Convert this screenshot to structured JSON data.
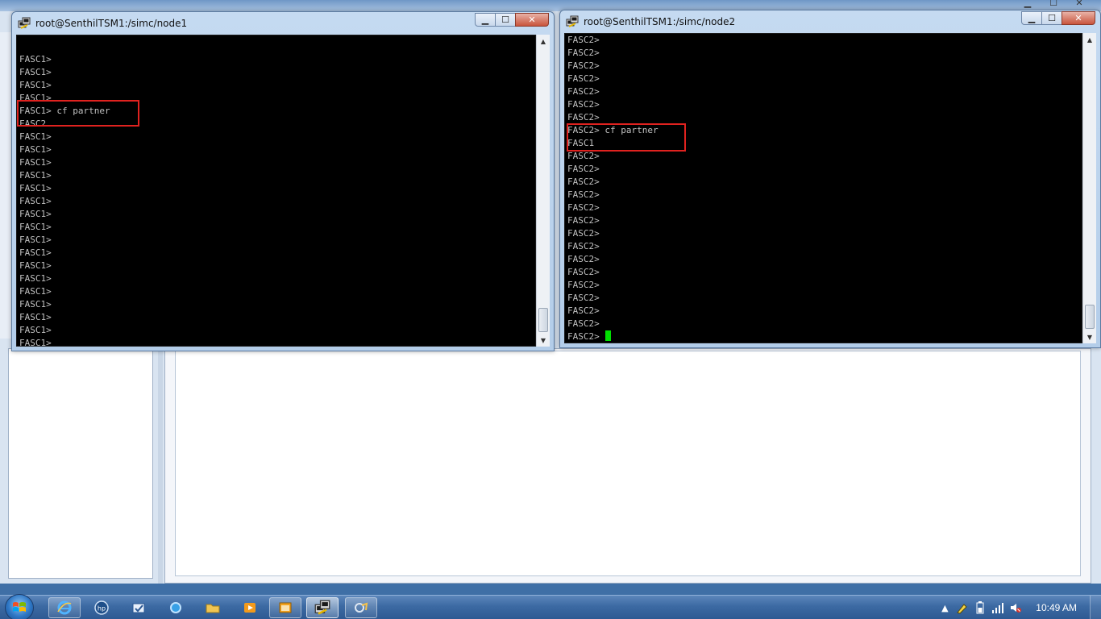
{
  "windows": [
    {
      "id": "node1",
      "title": "root@SenthilTSM1:/simc/node1",
      "lines": [
        "",
        "FASC1>",
        "FASC1>",
        "FASC1>",
        "FASC1>",
        "FASC1> cf partner",
        "FASC2",
        "FASC1>",
        "FASC1>",
        "FASC1>",
        "FASC1>",
        "FASC1>",
        "FASC1>",
        "FASC1>",
        "FASC1>",
        "FASC1>",
        "FASC1>",
        "FASC1>",
        "FASC1>",
        "FASC1>",
        "FASC1>",
        "FASC1>",
        "FASC1>",
        "FASC1>"
      ],
      "prompt": "FASC1> ",
      "cursor_style": "hollow"
    },
    {
      "id": "node2",
      "title": "root@SenthilTSM1:/simc/node2",
      "lines": [
        "FASC2>",
        "FASC2>",
        "FASC2>",
        "FASC2>",
        "FASC2>",
        "FASC2>",
        "FASC2>",
        "FASC2> cf partner",
        "FASC1",
        "FASC2>",
        "FASC2>",
        "FASC2>",
        "FASC2>",
        "FASC2>",
        "FASC2>",
        "FASC2>",
        "FASC2>",
        "FASC2>",
        "FASC2>",
        "FASC2>",
        "FASC2>",
        "FASC2>",
        "FASC2>"
      ],
      "prompt": "FASC2> ",
      "cursor_style": "solid"
    }
  ],
  "window_controls": {
    "minimize": "▁",
    "maximize": "☐",
    "close": "✕"
  },
  "taskbar": {
    "clock": "10:49 AM",
    "pinned": [
      "internet-explorer-icon",
      "hp-icon",
      "outlook-tasks-icon",
      "app-circle-icon",
      "folder-icon",
      "media-player-icon",
      "window-app-icon",
      "putty-icon",
      "putty-config-icon"
    ]
  },
  "colors": {
    "terminal_bg": "#000000",
    "terminal_fg": "#c0c0c0",
    "cursor": "#00e000",
    "highlight": "#e0221f",
    "titlebar": "#c5daf1"
  }
}
